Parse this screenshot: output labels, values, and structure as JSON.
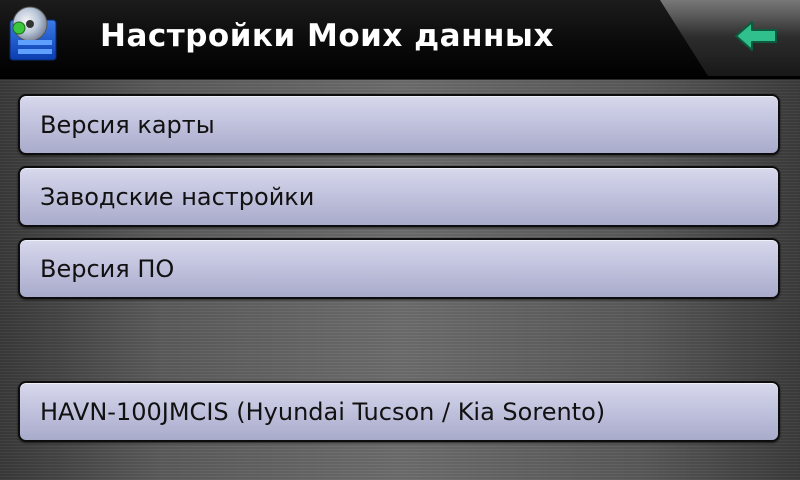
{
  "header": {
    "title": "Настройки Моих данных",
    "app_icon": "settings-disc-icon",
    "back_icon": "back-arrow-icon"
  },
  "menu": {
    "items": [
      {
        "label": "Версия карты"
      },
      {
        "label": "Заводские настройки"
      },
      {
        "label": "Версия ПО"
      },
      {
        "label": "HAVN-100JMCIS (Hyundai Tucson / Kia Sorento)"
      }
    ]
  },
  "colors": {
    "accent_arrow": "#2fc08e",
    "button_fill": "#c2c3de",
    "header_bg": "#0a0a0a"
  }
}
